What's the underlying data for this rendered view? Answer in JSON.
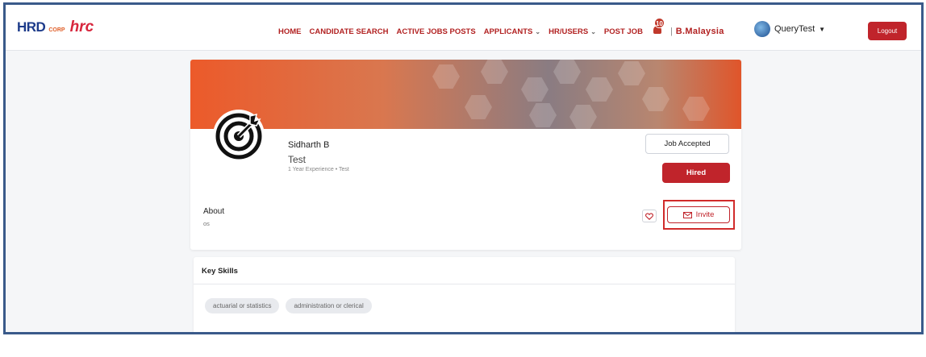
{
  "header": {
    "logo_primary": "HRD",
    "logo_secondary": "CORP",
    "logo_partner": "hrc",
    "nav": [
      {
        "label": "HOME",
        "has_dropdown": false
      },
      {
        "label": "CANDIDATE SEARCH",
        "has_dropdown": false
      },
      {
        "label": "ACTIVE JOBS POSTS",
        "has_dropdown": false
      },
      {
        "label": "APPLICANTS",
        "has_dropdown": true
      },
      {
        "label": "HR/USERS",
        "has_dropdown": true
      },
      {
        "label": "POST JOB",
        "has_dropdown": false
      }
    ],
    "notification_count": "10",
    "separator": "|",
    "region": "B.Malaysia",
    "user_name": "QueryTest",
    "logout_label": "Logout"
  },
  "profile": {
    "name": "Sidharth B",
    "subtitle": "Test",
    "meta": "1 Year Experience • Test",
    "job_accepted_label": "Job Accepted",
    "hired_label": "Hired",
    "about_title": "About",
    "about_text": "os",
    "invite_label": "Invite"
  },
  "skills": {
    "title": "Key Skills",
    "items": [
      "actuarial or statistics",
      "administration or clerical"
    ]
  },
  "colors": {
    "brand_red": "#c0242b",
    "nav_red": "#b22222",
    "frame_blue": "#3a5a8a"
  }
}
